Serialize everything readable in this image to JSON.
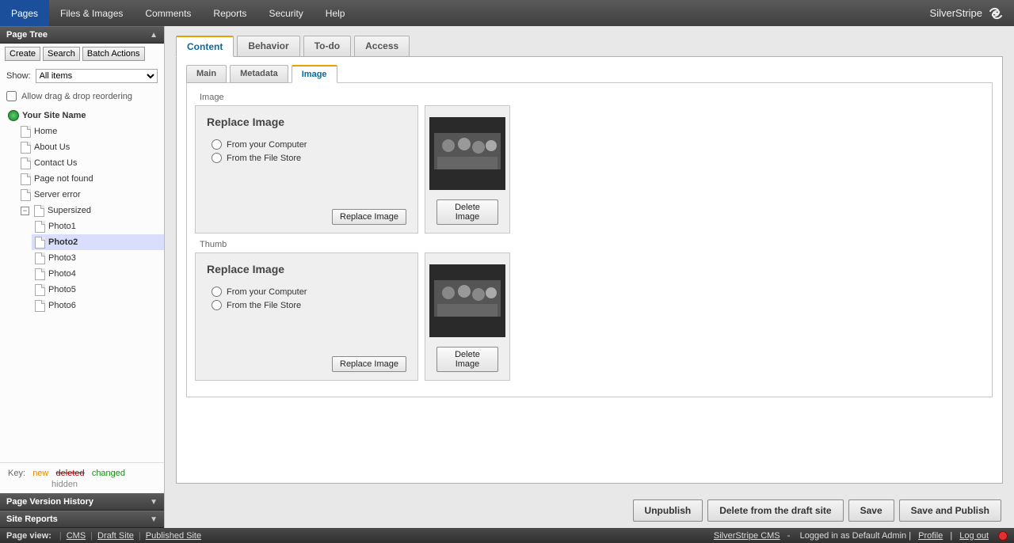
{
  "topmenu": {
    "items": [
      "Pages",
      "Files & Images",
      "Comments",
      "Reports",
      "Security",
      "Help"
    ],
    "active_index": 0,
    "brand": "SilverStripe"
  },
  "sidebar": {
    "pagetree_title": "Page Tree",
    "buttons": {
      "create": "Create",
      "search": "Search",
      "batch": "Batch Actions"
    },
    "show_label": "Show:",
    "show_value": "All items",
    "allow_label": "Allow drag & drop reordering",
    "root_label": "Your Site Name",
    "pages": [
      "Home",
      "About Us",
      "Contact Us",
      "Page not found",
      "Server error"
    ],
    "super_label": "Supersized",
    "photos": [
      "Photo1",
      "Photo2",
      "Photo3",
      "Photo4",
      "Photo5",
      "Photo6"
    ],
    "selected_photo_index": 1,
    "key": {
      "label": "Key:",
      "new": "new",
      "deleted": "deleted",
      "changed": "changed",
      "hidden": "hidden"
    },
    "panel_history": "Page Version History",
    "panel_reports": "Site Reports"
  },
  "tabs1": {
    "items": [
      "Content",
      "Behavior",
      "To-do",
      "Access"
    ],
    "active_index": 0
  },
  "tabs2": {
    "items": [
      "Main",
      "Metadata",
      "Image"
    ],
    "active_index": 2
  },
  "fields": {
    "image": {
      "label": "Image",
      "card_title": "Replace Image",
      "opt1": "From your Computer",
      "opt2": "From the File Store",
      "replace_btn": "Replace Image",
      "delete_btn": "Delete Image"
    },
    "thumb": {
      "label": "Thumb",
      "card_title": "Replace Image",
      "opt1": "From your Computer",
      "opt2": "From the File Store",
      "replace_btn": "Replace Image",
      "delete_btn": "Delete Image"
    }
  },
  "actions": {
    "unpublish": "Unpublish",
    "delete": "Delete from the draft site",
    "save": "Save",
    "publish": "Save and Publish"
  },
  "footer": {
    "label": "Page view:",
    "links": [
      "CMS",
      "Draft Site",
      "Published Site"
    ],
    "cms_name": "SilverStripe CMS",
    "logged_in": "Logged in as Default Admin",
    "profile": "Profile",
    "logout": "Log out"
  }
}
